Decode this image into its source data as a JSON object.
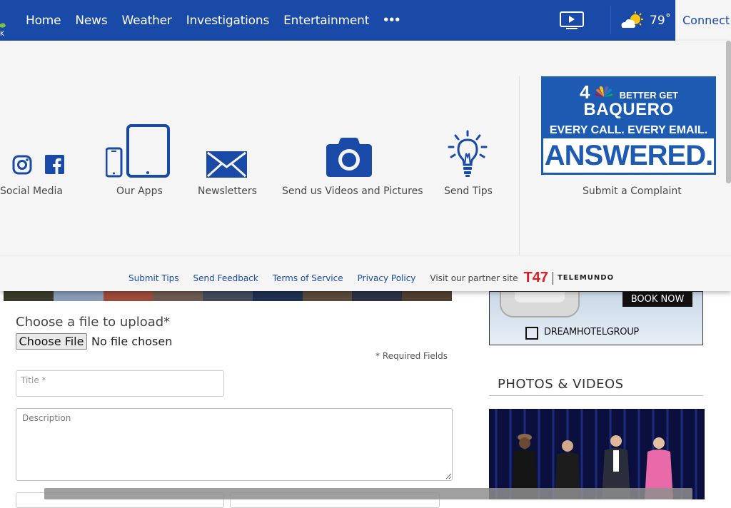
{
  "nav": {
    "items": [
      "Home",
      "News",
      "Weather",
      "Investigations",
      "Entertainment"
    ],
    "more_label": "•••",
    "temperature": "79˚",
    "connect_label": "Connect"
  },
  "panel": {
    "features": [
      {
        "label": "Social Media",
        "icon": "instagram-facebook-icons"
      },
      {
        "label": "Our Apps",
        "icon": "devices-icon"
      },
      {
        "label": "Newsletters",
        "icon": "envelope-icon"
      },
      {
        "label": "Send us Videos and Pictures",
        "icon": "camera-icon"
      },
      {
        "label": "Send Tips",
        "icon": "lightbulb-icon"
      }
    ],
    "ad": {
      "line1": "BETTER GET",
      "line2": "BAQUERO",
      "line3": "EVERY CALL. EVERY EMAIL.",
      "line4": "ANSWERED.",
      "channel": "4"
    },
    "complaint_label": "Submit a Complaint",
    "footer": {
      "links": [
        "Submit Tips",
        "Send Feedback",
        "Terms of Service",
        "Privacy Policy"
      ],
      "partner_text": "Visit our partner site",
      "partner_mark": "T47",
      "partner_name": "TELEMUNDO"
    }
  },
  "form": {
    "upload_label": "Choose a file to upload*",
    "choose_button": "Choose File",
    "no_file": "No file chosen",
    "required_note": "*  Required Fields",
    "title_placeholder": "Title *",
    "description_placeholder": "Description"
  },
  "sidebar": {
    "ad_button": "BOOK NOW",
    "ad_brand": "DREAMHOTELGROUP",
    "photos_videos_title": "PHOTOS & VIDEOS"
  },
  "colors": {
    "brand_blue": "#1a4aa8",
    "panel_bg": "#f5f5f5",
    "icon_blue": "#1a4aa8"
  }
}
